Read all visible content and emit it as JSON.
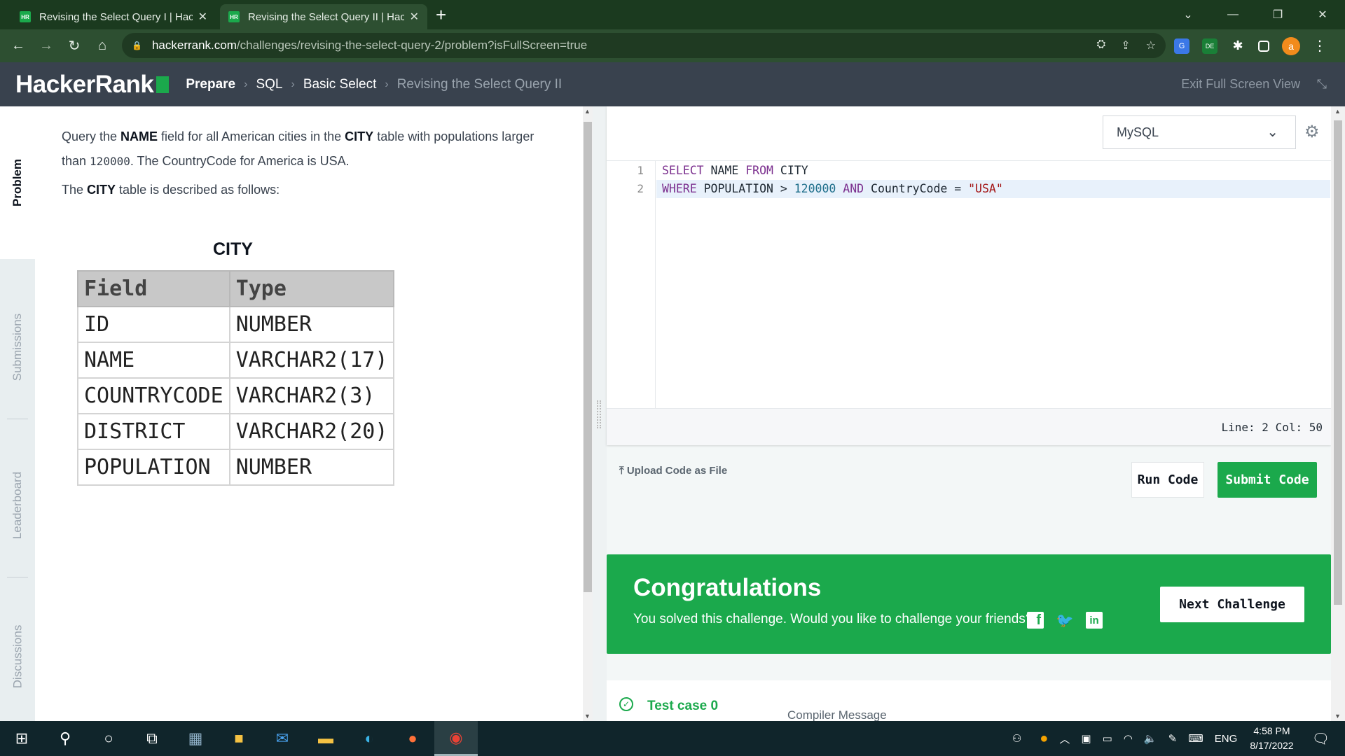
{
  "browser": {
    "tabs": [
      {
        "title": "Revising the Select Query I | HackerRank",
        "favicon": "HR"
      },
      {
        "title": "Revising the Select Query II | HackerRank",
        "favicon": "HR"
      }
    ],
    "new_tab": "+",
    "address": {
      "host": "hackerrank.com",
      "path": "/challenges/revising-the-select-query-2/problem?isFullScreen=true"
    },
    "profile_initial": "a",
    "extension_badge": "DE"
  },
  "header": {
    "logo": "HackerRank",
    "breadcrumb": [
      "Prepare",
      "SQL",
      "Basic Select",
      "Revising the Select Query II"
    ],
    "exit_fullscreen": "Exit Full Screen View"
  },
  "side_tabs": [
    "Problem",
    "Submissions",
    "Leaderboard",
    "Discussions"
  ],
  "problem": {
    "p1_a": "Query the ",
    "p1_b": "NAME",
    "p1_c": " field for all American cities in the ",
    "p1_d": "CITY",
    "p1_e": " table with populations larger than ",
    "p1_f": "120000",
    "p1_g": ". The CountryCode for America is ",
    "p1_h": "USA",
    "p1_i": ".",
    "p2_a": "The ",
    "p2_b": "CITY",
    "p2_c": " table is described as follows:",
    "table_caption": "CITY",
    "table_headers": [
      "Field",
      "Type"
    ],
    "table_rows": [
      [
        "ID",
        "NUMBER"
      ],
      [
        "NAME",
        "VARCHAR2(17)"
      ],
      [
        "COUNTRYCODE",
        "VARCHAR2(3)"
      ],
      [
        "DISTRICT",
        "VARCHAR2(20)"
      ],
      [
        "POPULATION",
        "NUMBER"
      ]
    ]
  },
  "editor": {
    "language": "MySQL",
    "lines": [
      {
        "n": "1",
        "tokens": [
          [
            "kw",
            "SELECT"
          ],
          [
            "t",
            " NAME "
          ],
          [
            "kw",
            "FROM"
          ],
          [
            "t",
            " CITY"
          ]
        ]
      },
      {
        "n": "2",
        "tokens": [
          [
            "kw",
            "WHERE"
          ],
          [
            "t",
            " POPULATION > "
          ],
          [
            "num",
            "120000"
          ],
          [
            "t",
            " "
          ],
          [
            "kw",
            "AND"
          ],
          [
            "t",
            " CountryCode = "
          ],
          [
            "str",
            "\"USA\""
          ]
        ]
      }
    ],
    "status": "Line: 2 Col: 50"
  },
  "actions": {
    "upload": "Upload Code as File",
    "run": "Run Code",
    "submit": "Submit Code"
  },
  "congrats": {
    "title": "Congratulations",
    "subtitle": "You solved this challenge. Would you like to challenge your friends?",
    "next": "Next Challenge"
  },
  "results": {
    "test_case": "Test case 0",
    "compiler_message": "Compiler Message"
  },
  "taskbar": {
    "language": "ENG",
    "time": "4:58 PM",
    "date": "8/17/2022"
  },
  "colors": {
    "hr_green": "#1ba94c",
    "hr_header": "#39424e",
    "chrome_dark": "#1b3a1f"
  }
}
